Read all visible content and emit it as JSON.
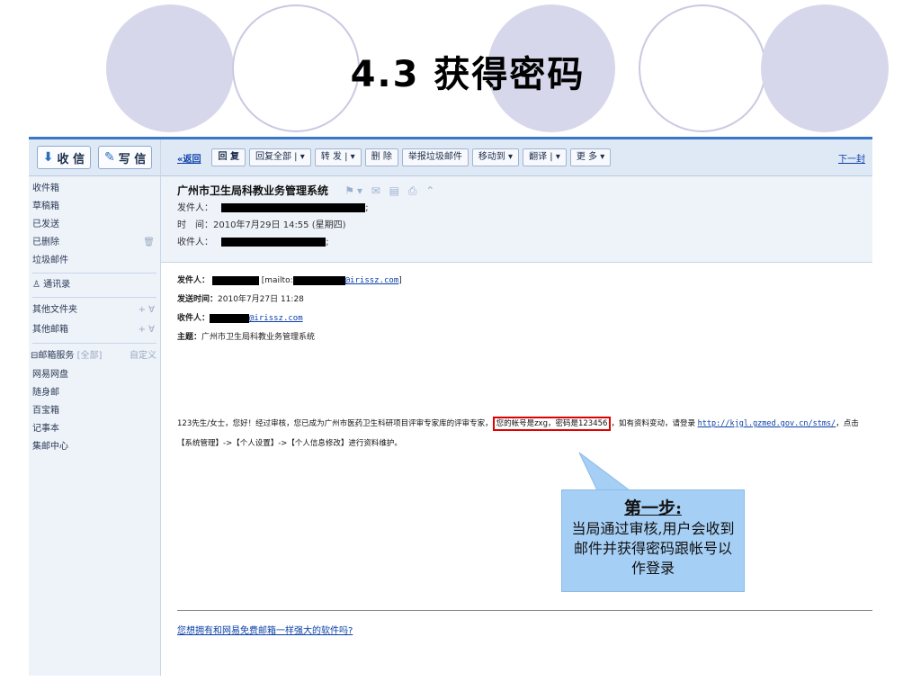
{
  "slide": {
    "title": "4.3 获得密码"
  },
  "sidebar": {
    "receive_label": "收 信",
    "write_label": "写 信",
    "items": [
      {
        "label": "收件箱"
      },
      {
        "label": "草稿箱"
      },
      {
        "label": "已发送"
      },
      {
        "label": "已删除"
      },
      {
        "label": "垃圾邮件"
      }
    ],
    "contacts": "通讯录",
    "other_folders": "其他文件夹",
    "other_mailboxes": "其他邮箱",
    "plus_label": "+ ∀",
    "services_title": "邮箱服务",
    "services_all": "[全部]",
    "services_custom": "自定义",
    "services": [
      {
        "label": "网易网盘"
      },
      {
        "label": "随身邮"
      },
      {
        "label": "百宝箱"
      },
      {
        "label": "记事本"
      },
      {
        "label": "集邮中心"
      }
    ]
  },
  "toolbar": {
    "back": "«返回",
    "reply": "回 复",
    "reply_all": "回复全部",
    "forward": "转 发",
    "delete": "删 除",
    "report_spam": "举报垃圾邮件",
    "move_to": "移动到",
    "translate": "翻译",
    "more": "更 多",
    "next": "下一封",
    "dropdown": "▾"
  },
  "mail": {
    "subject": "广州市卫生局科教业务管理系统",
    "sender_label": "发件人：",
    "time_label": "时　间：",
    "time_value": "2010年7月29日 14:55 (星期四)",
    "recipient_label": "收件人：",
    "semicolon": ";",
    "quoted": {
      "from_label": "发件人：",
      "mailto_prefix": "[mailto:",
      "from_domain": "@irissz.com",
      "mailto_suffix": "]",
      "sent_label": "发送时间：",
      "sent_value": "2010年7月27日 11:28",
      "to_label": "收件人：",
      "to_domain": "@irissz.com",
      "subject_label": "主题：",
      "subject_value": "广州市卫生局科教业务管理系统"
    },
    "body_line1_a": "123先生/女士，您好！经过审核，您已成为广州市医药卫生科研项目评审专家库的评审专家，",
    "body_highlight": "您的帐号是zxg，密码是123456",
    "body_line1_b": "，如有资料变动，请登录",
    "body_link": "http://kjgl.gzmed.gov.cn/stms/",
    "body_line1_c": "，点击",
    "body_line2": "【系统管理】->【个人设置】->【个人信息修改】进行资料维护。",
    "footer_link": "您想拥有和网易免费邮箱一样强大的软件吗?"
  },
  "callout": {
    "step": "第一步:",
    "desc": "当局通过审核,用户会收到邮件并获得密码跟帐号以作登录"
  },
  "colors": {
    "accent": "#3a77c8",
    "callout_bg": "#a6cff5",
    "highlight_border": "#e00000",
    "circle_fill": "#d7d7ec"
  }
}
